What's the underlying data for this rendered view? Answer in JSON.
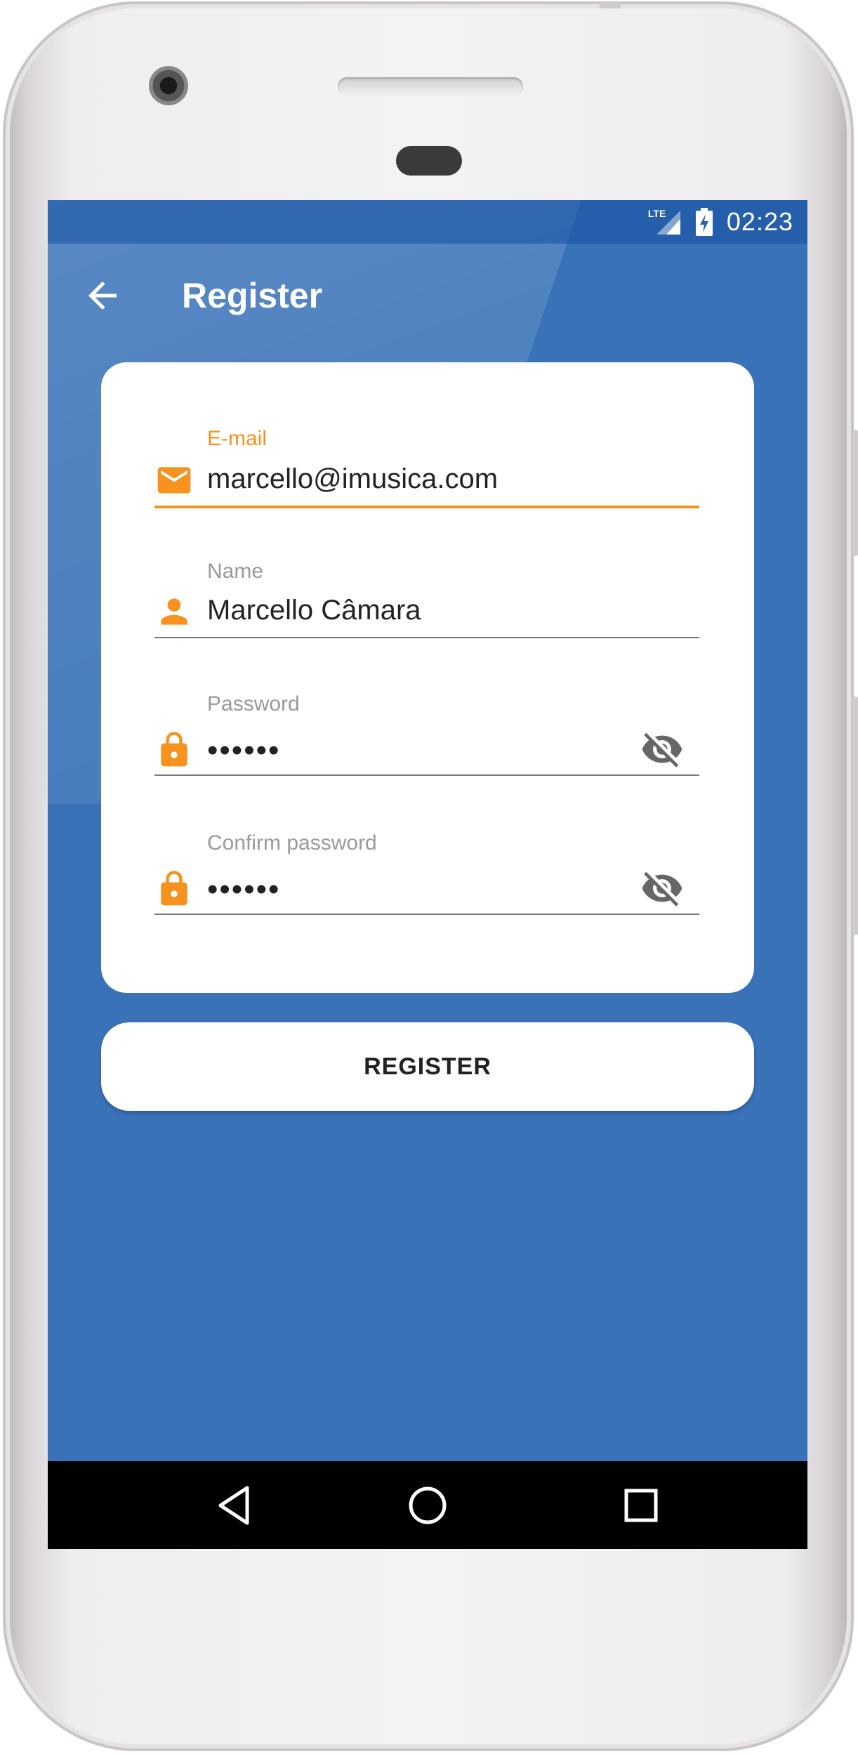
{
  "status_bar": {
    "network": "LTE",
    "time": "02:23"
  },
  "app_bar": {
    "title": "Register",
    "back_icon": "arrow-left-icon"
  },
  "form": {
    "email": {
      "label": "E-mail",
      "value": "marcello@imusica.com",
      "icon": "envelope-icon",
      "focused": true
    },
    "name": {
      "label": "Name",
      "value": "Marcello Câmara",
      "icon": "person-icon"
    },
    "password": {
      "label": "Password",
      "value": "••••••",
      "icon": "lock-icon",
      "toggle_icon": "eye-off-icon"
    },
    "confirm_password": {
      "label": "Confirm password",
      "value": "••••••",
      "icon": "lock-icon",
      "toggle_icon": "eye-off-icon"
    }
  },
  "register_button": {
    "label": "REGISTER"
  },
  "nav_bar": {
    "back": "triangle-back-icon",
    "home": "circle-home-icon",
    "recents": "square-recents-icon"
  },
  "colors": {
    "screen_bg": "#3a72b8",
    "accent": "#f7921e",
    "status_bar": "#1c58a8"
  }
}
